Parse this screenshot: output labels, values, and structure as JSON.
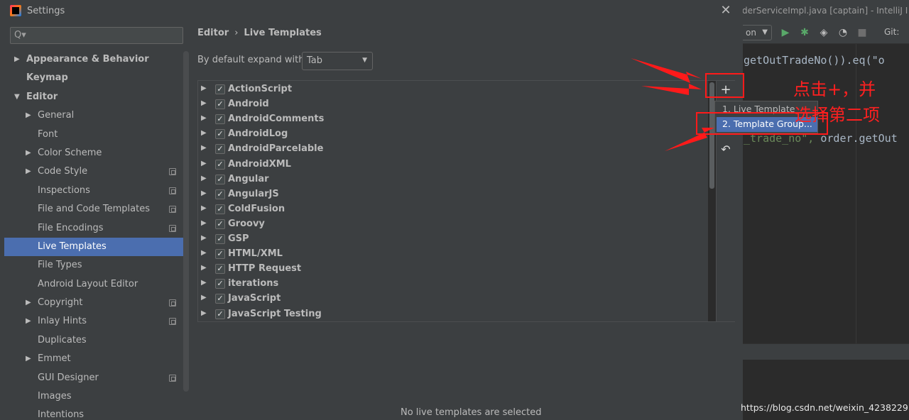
{
  "ide": {
    "window_title": "derServiceImpl.java [captain] - IntelliJ I",
    "run_config": "on",
    "git_label": "Git:",
    "code_lines": [
      {
        "str": "",
        "plain": "getOutTradeNo()).eq(\"o"
      },
      {
        "str": "_trade_no\",",
        "plain": " order.getOut"
      }
    ],
    "watermark": "https://blog.csdn.net/weixin_42382291"
  },
  "dialog": {
    "title": "Settings",
    "close_glyph": "✕",
    "search": {
      "placeholder": "Q▾",
      "value": ""
    },
    "tree": [
      {
        "label": "Appearance & Behavior",
        "level": 0,
        "bold": true,
        "arrow": "▶",
        "badge": false,
        "selected": false
      },
      {
        "label": "Keymap",
        "level": 0,
        "bold": true,
        "arrow": "",
        "badge": false,
        "selected": false
      },
      {
        "label": "Editor",
        "level": 0,
        "bold": true,
        "arrow": "▼",
        "badge": false,
        "selected": false
      },
      {
        "label": "General",
        "level": 1,
        "bold": false,
        "arrow": "▶",
        "badge": false,
        "selected": false
      },
      {
        "label": "Font",
        "level": 1,
        "bold": false,
        "arrow": "",
        "badge": false,
        "selected": false
      },
      {
        "label": "Color Scheme",
        "level": 1,
        "bold": false,
        "arrow": "▶",
        "badge": false,
        "selected": false
      },
      {
        "label": "Code Style",
        "level": 1,
        "bold": false,
        "arrow": "▶",
        "badge": true,
        "selected": false
      },
      {
        "label": "Inspections",
        "level": 1,
        "bold": false,
        "arrow": "",
        "badge": true,
        "selected": false
      },
      {
        "label": "File and Code Templates",
        "level": 1,
        "bold": false,
        "arrow": "",
        "badge": true,
        "selected": false
      },
      {
        "label": "File Encodings",
        "level": 1,
        "bold": false,
        "arrow": "",
        "badge": true,
        "selected": false
      },
      {
        "label": "Live Templates",
        "level": 1,
        "bold": false,
        "arrow": "",
        "badge": false,
        "selected": true
      },
      {
        "label": "File Types",
        "level": 1,
        "bold": false,
        "arrow": "",
        "badge": false,
        "selected": false
      },
      {
        "label": "Android Layout Editor",
        "level": 1,
        "bold": false,
        "arrow": "",
        "badge": false,
        "selected": false
      },
      {
        "label": "Copyright",
        "level": 1,
        "bold": false,
        "arrow": "▶",
        "badge": true,
        "selected": false
      },
      {
        "label": "Inlay Hints",
        "level": 1,
        "bold": false,
        "arrow": "▶",
        "badge": true,
        "selected": false
      },
      {
        "label": "Duplicates",
        "level": 1,
        "bold": false,
        "arrow": "",
        "badge": false,
        "selected": false
      },
      {
        "label": "Emmet",
        "level": 1,
        "bold": false,
        "arrow": "▶",
        "badge": false,
        "selected": false
      },
      {
        "label": "GUI Designer",
        "level": 1,
        "bold": false,
        "arrow": "",
        "badge": true,
        "selected": false
      },
      {
        "label": "Images",
        "level": 1,
        "bold": false,
        "arrow": "",
        "badge": false,
        "selected": false
      },
      {
        "label": "Intentions",
        "level": 1,
        "bold": false,
        "arrow": "",
        "badge": false,
        "selected": false
      }
    ],
    "breadcrumb": {
      "parent": "Editor",
      "separator": "›",
      "current": "Live Templates"
    },
    "expand": {
      "label": "By default expand with",
      "value": "Tab",
      "dropdown_glyph": "▼"
    },
    "template_groups": [
      "ActionScript",
      "Android",
      "AndroidComments",
      "AndroidLog",
      "AndroidParcelable",
      "AndroidXML",
      "Angular",
      "AngularJS",
      "ColdFusion",
      "Groovy",
      "GSP",
      "HTML/XML",
      "HTTP Request",
      "iterations",
      "JavaScript",
      "JavaScript Testing"
    ],
    "check_glyph": "✓",
    "expand_glyph": "▶",
    "toolbar": {
      "add": "+",
      "undo": "↶"
    },
    "popup": {
      "items": [
        "1. Live Template",
        "2. Template Group..."
      ],
      "selected_index": 1
    },
    "empty_message": "No live templates are selected"
  },
  "annotation": {
    "line1": "点击+，并",
    "line2": "选择第二项",
    "color": "#ff1a1a"
  }
}
